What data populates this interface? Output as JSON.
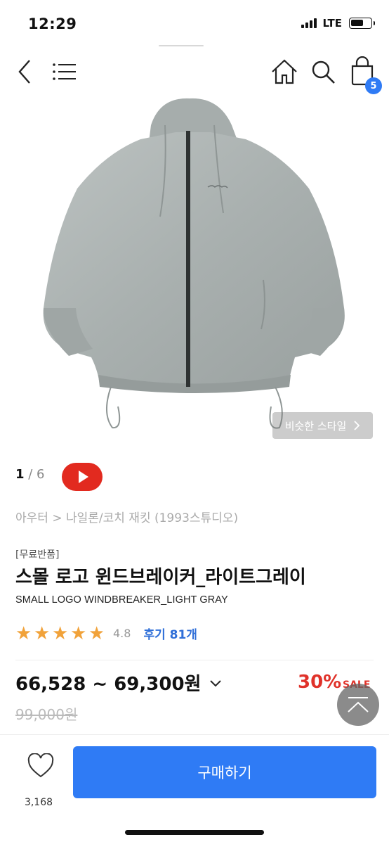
{
  "status_bar": {
    "time": "12:29",
    "network": "LTE",
    "battery_fraction": 0.62
  },
  "nav": {
    "cart_count": "5",
    "icons": [
      "back-icon",
      "menu-icon",
      "home-icon",
      "search-icon",
      "cart-icon"
    ]
  },
  "product": {
    "similar_style_label": "비슷한 스타일",
    "pager_current": "1",
    "pager_total": " / 6",
    "breadcrumb": "아우터 > 나일론/코치 재킷 (1993스튜디오)",
    "tag": "[무료반품]",
    "title": "스몰 로고 윈드브레이커_라이트그레이",
    "subtitle": "SMALL LOGO WINDBREAKER_LIGHT GRAY",
    "rating": "4.8",
    "rating_stars": 4.8,
    "review_link": "후기 81개",
    "price_range": "66,528 ~ 69,300원",
    "discount": "30%",
    "sale_label": "SALE",
    "original_price": "99,000원"
  },
  "bottom_bar": {
    "like_count": "3,168",
    "buy_label": "구매하기"
  },
  "colors": {
    "accent": "#2f7bf5",
    "sale": "#e0322a",
    "star": "#f1a23a",
    "youtube": "#e22a1f"
  }
}
